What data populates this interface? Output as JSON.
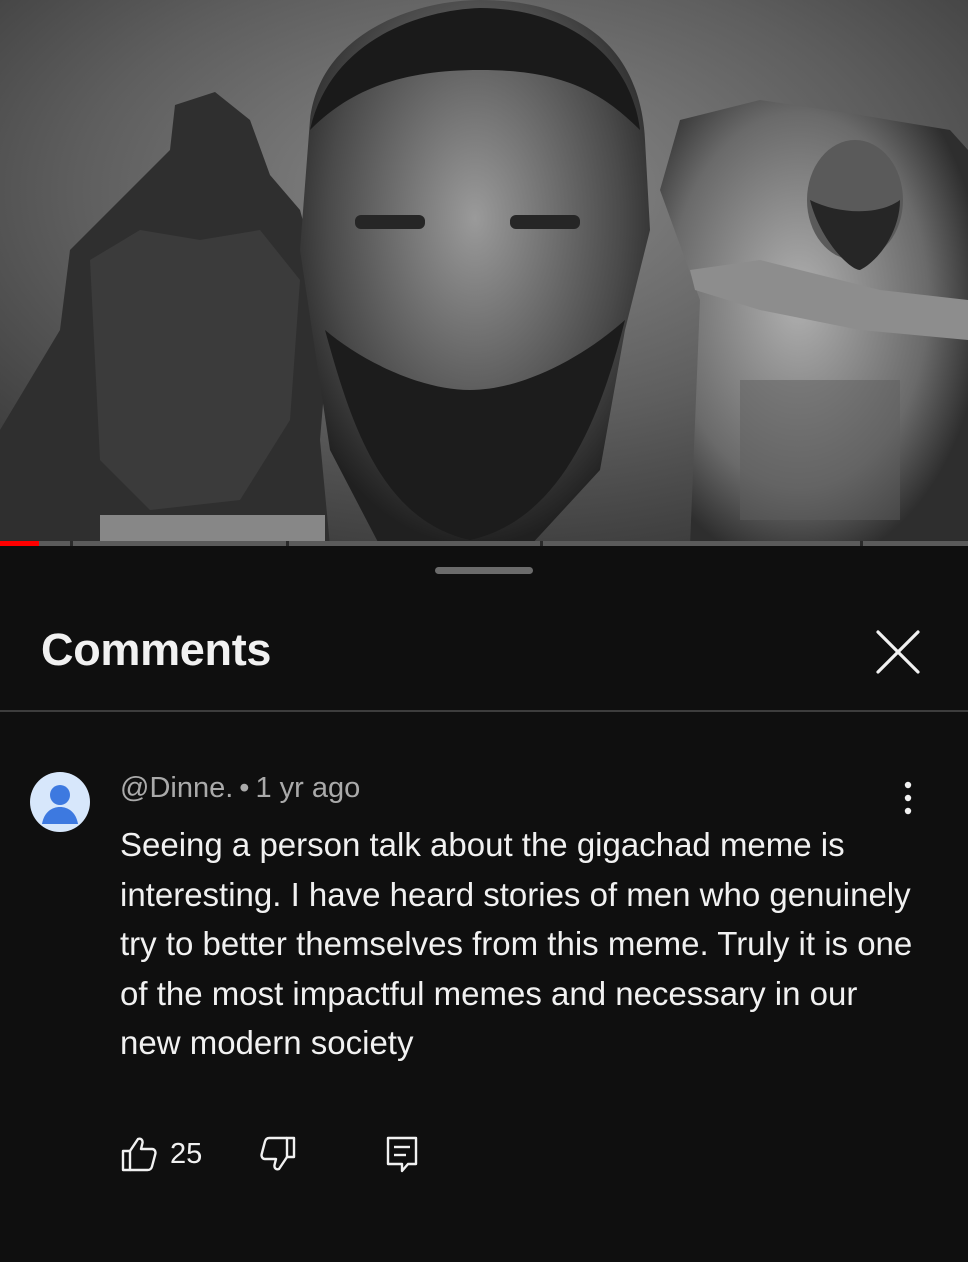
{
  "video": {
    "progress_fraction": 0.04,
    "accent_color": "#ff0000"
  },
  "comments_panel": {
    "title": "Comments",
    "close_icon": "close-icon"
  },
  "comment": {
    "author": "@Dinne.",
    "separator": "•",
    "time": "1 yr ago",
    "text": "Seeing a person talk about the gigachad meme is interesting. I have heard stories of men who genuinely try to better themselves from this meme. Truly it is one of the most impactful memes and necessary in our new modern society",
    "likes": "25",
    "icons": {
      "avatar": "default-avatar-icon",
      "more": "more-vert-icon",
      "like": "thumbs-up-icon",
      "dislike": "thumbs-down-icon",
      "reply": "reply-comment-icon"
    }
  }
}
